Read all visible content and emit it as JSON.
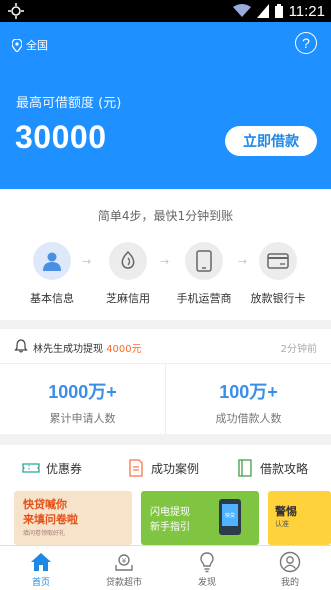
{
  "status_bar": {
    "time": "11:21",
    "icons": [
      "wifi-icon",
      "signal-icon",
      "battery-icon"
    ]
  },
  "header": {
    "location": "全国",
    "help_icon": "?"
  },
  "hero": {
    "label": "最高可借额度 (元)",
    "amount": "30000",
    "borrow_button": "立即借款"
  },
  "steps": {
    "tagline": "简单4步，最快1分钟到账",
    "items": [
      {
        "label": "基本信息",
        "icon": "user-icon"
      },
      {
        "label": "芝麻信用",
        "icon": "sesame-icon"
      },
      {
        "label": "手机运营商",
        "icon": "phone-icon"
      },
      {
        "label": "放款银行卡",
        "icon": "bankcard-icon"
      }
    ]
  },
  "notice": {
    "message": "林先生成功提现",
    "amount": "4000元",
    "time_ago": "2分钟前"
  },
  "stats": [
    {
      "value": "1000万+",
      "caption": "累计申请人数"
    },
    {
      "value": "100万+",
      "caption": "成功借款人数"
    }
  ],
  "quick_links": [
    {
      "label": "优惠券",
      "icon": "coupon-icon"
    },
    {
      "label": "成功案例",
      "icon": "case-icon"
    },
    {
      "label": "借款攻略",
      "icon": "guide-icon"
    }
  ],
  "banners": [
    {
      "line1": "快贷喊你",
      "line2": "来填问卷啦",
      "line3": "填问卷领取好礼"
    },
    {
      "line1": "闪电提现",
      "line2": "新手指引",
      "phone_text": "快贷"
    },
    {
      "line1": "警惕",
      "line2": "认准"
    }
  ],
  "tabs": [
    {
      "label": "首页",
      "icon": "home-icon",
      "active": true
    },
    {
      "label": "贷款超市",
      "icon": "market-icon",
      "active": false
    },
    {
      "label": "发现",
      "icon": "bulb-icon",
      "active": false
    },
    {
      "label": "我的",
      "icon": "profile-icon",
      "active": false
    }
  ],
  "colors": {
    "primary": "#1e90ff",
    "accent_orange": "#ff6a2b",
    "stat_blue": "#3b8ee8"
  }
}
